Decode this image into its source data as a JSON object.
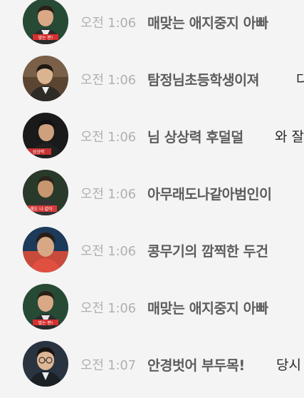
{
  "chat": {
    "messages": [
      {
        "time": "오전 1:06",
        "nickname": "매맞는 애지중지 아빠",
        "text": "",
        "avatar_icon": "user-avatar-tvshow",
        "avatar_bg": "#1f3a2c",
        "avatar_accent": "#d63030"
      },
      {
        "time": "오전 1:06",
        "nickname": "탐정님초등학생이져",
        "text": "다",
        "avatar_icon": "user-avatar-man",
        "avatar_bg": "#5a4532",
        "avatar_accent": "#d9b48f"
      },
      {
        "time": "오전 1:06",
        "nickname": "님 상상력 후덜덜",
        "text": "와 잘",
        "avatar_icon": "user-avatar-tvshow",
        "avatar_bg": "#1a1a1a",
        "avatar_accent": "#c83232"
      },
      {
        "time": "오전 1:06",
        "nickname": "아무래도나같아범인이",
        "text": "",
        "avatar_icon": "user-avatar-tvshow",
        "avatar_bg": "#2a3a2a",
        "avatar_accent": "#d63a3a"
      },
      {
        "time": "오전 1:06",
        "nickname": "콩무기의 깜찍한 두건",
        "text": "",
        "avatar_icon": "user-avatar-man",
        "avatar_bg": "#1c3a5a",
        "avatar_accent": "#c84a3a"
      },
      {
        "time": "오전 1:06",
        "nickname": "매맞는 애지중지 아빠",
        "text": "",
        "avatar_icon": "user-avatar-tvshow",
        "avatar_bg": "#1f3a2c",
        "avatar_accent": "#d63030"
      },
      {
        "time": "오전 1:07",
        "nickname": "안경벗어 부두목!",
        "text": "당시",
        "avatar_icon": "user-avatar-glasses",
        "avatar_bg": "#2a3440",
        "avatar_accent": "#e8ecef"
      }
    ]
  }
}
